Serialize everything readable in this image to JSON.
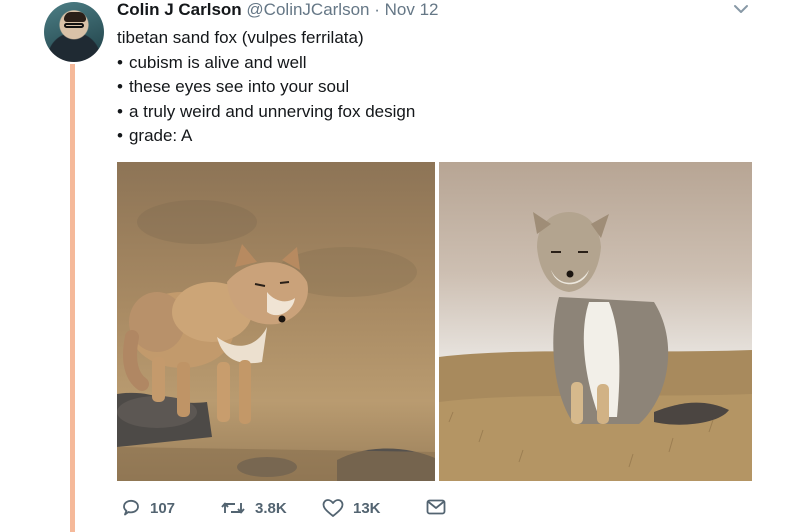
{
  "tweet": {
    "author_name": "Colin J Carlson",
    "handle": "@ColinJCarlson",
    "separator": "·",
    "date": "Nov 12",
    "text_lines": [
      "tibetan sand fox (vulpes ferrilata)",
      "cubism is alive and well",
      "these eyes see into your soul",
      "a truly weird and unnerving fox design",
      "grade: A"
    ],
    "images": [
      "fox-standing-photo",
      "fox-sitting-photo"
    ]
  },
  "actions": {
    "reply_count": "107",
    "retweet_count": "3.8K",
    "like_count": "13K"
  },
  "icons": [
    "chevron-down-icon",
    "reply-icon",
    "retweet-icon",
    "like-icon",
    "message-icon"
  ],
  "colors": {
    "thread_line": "#f5b99a",
    "secondary_text": "#657786",
    "icon": "#536471"
  }
}
